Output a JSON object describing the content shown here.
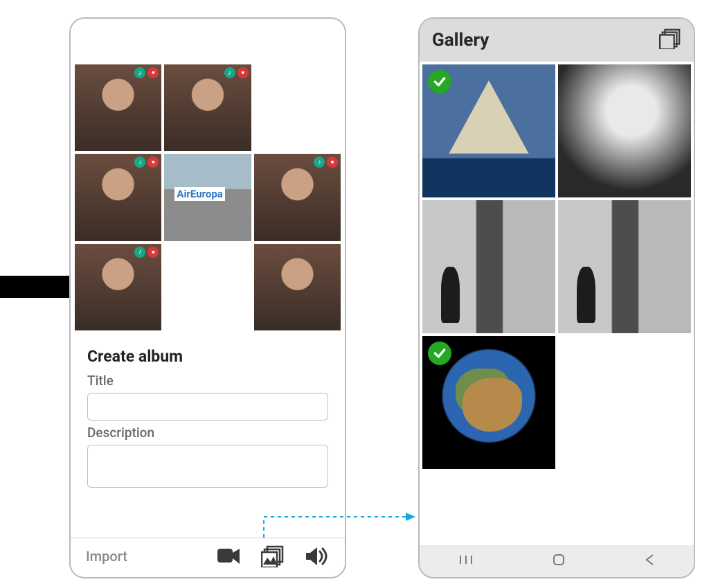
{
  "left_panel": {
    "heading": "Create album",
    "title_label": "Title",
    "description_label": "Description",
    "title_value": "",
    "description_value": "",
    "import_label": "Import",
    "thumbs": [
      {
        "music": true,
        "video": true,
        "kind": "person"
      },
      {
        "music": true,
        "video": true,
        "kind": "person"
      },
      {
        "music": false,
        "video": false,
        "kind": "empty"
      },
      {
        "music": true,
        "video": true,
        "kind": "person"
      },
      {
        "music": false,
        "video": false,
        "kind": "plane"
      },
      {
        "music": true,
        "video": true,
        "kind": "person"
      },
      {
        "music": true,
        "video": true,
        "kind": "person"
      },
      {
        "music": false,
        "video": false,
        "kind": "empty"
      },
      {
        "music": false,
        "video": false,
        "kind": "person"
      }
    ]
  },
  "right_panel": {
    "title": "Gallery",
    "photos": [
      {
        "selected": true,
        "kind": "ship"
      },
      {
        "selected": false,
        "kind": "bw"
      },
      {
        "selected": false,
        "kind": "street"
      },
      {
        "selected": false,
        "kind": "street"
      },
      {
        "selected": true,
        "kind": "globe"
      }
    ]
  }
}
